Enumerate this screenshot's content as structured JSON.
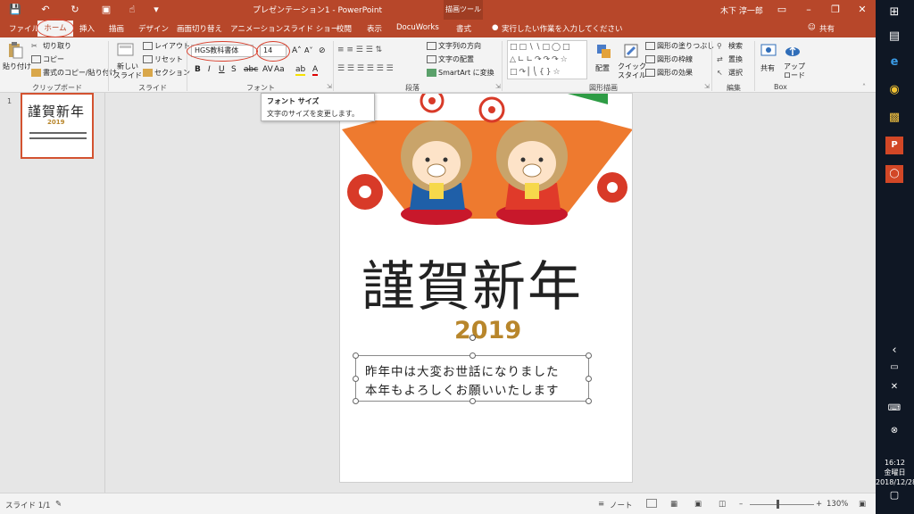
{
  "titlebar": {
    "title": "プレゼンテーション1  -  PowerPoint",
    "context_tab": "描画ツール",
    "user": "木下 淳一郎"
  },
  "tabs": {
    "file": "ファイル",
    "home": "ホーム",
    "insert": "挿入",
    "draw": "描画",
    "design": "デザイン",
    "transitions": "画面切り替え",
    "animations": "アニメーション",
    "slideshow": "スライド ショー",
    "review": "校閲",
    "view": "表示",
    "docuworks": "DocuWorks",
    "format": "書式",
    "tell_me": "実行したい作業を入力してください",
    "share": "共有"
  },
  "ribbon": {
    "paste": "貼り付け",
    "cut": "切り取り",
    "copy": "コピー",
    "format_painter": "書式のコピー/貼り付け",
    "clipboard_group": "クリップボード",
    "new_slide": "新しい\nスライド",
    "layout": "レイアウト",
    "reset": "リセット",
    "section": "セクション",
    "slides_group": "スライド",
    "font_name": "HGS教科書体",
    "font_size": "14",
    "font_group": "フォント",
    "text_direction": "文字列の方向",
    "align_text": "文字の配置",
    "smartart": "SmartArt に変換",
    "paragraph_group": "段落",
    "arrange": "配置",
    "quick_styles": "クイック\nスタイル",
    "shape_fill": "図形の塗りつぶし",
    "shape_outline": "図形の枠線",
    "shape_effects": "図形の効果",
    "drawing_group": "図形描画",
    "find": "検索",
    "replace": "置換",
    "select": "選択",
    "editing_group": "編集",
    "box_share": "共有",
    "upload": "アップ\nロード",
    "box_group": "Box"
  },
  "tooltip": {
    "title": "フォント サイズ",
    "description": "文字のサイズを変更します。"
  },
  "slide": {
    "number": "1",
    "heading": "謹賀新年",
    "year": "2019",
    "greeting_line1": "昨年中は大変お世話になりました",
    "greeting_line2": "本年もよろしくお願いいたします"
  },
  "statusbar": {
    "slide_counter": "スライド 1/1",
    "notes": "ノート",
    "zoom": "130%"
  },
  "taskbar": {
    "time": "16:12",
    "weekday": "金曜日",
    "date": "2018/12/28"
  },
  "colors": {
    "accent": "#b7472a",
    "fan_orange": "#ee7a2f",
    "kimono_blue": "#1f5fa8",
    "kimono_red": "#e03a2a",
    "gold": "#b8862b",
    "annotation_red": "#d9402d"
  }
}
